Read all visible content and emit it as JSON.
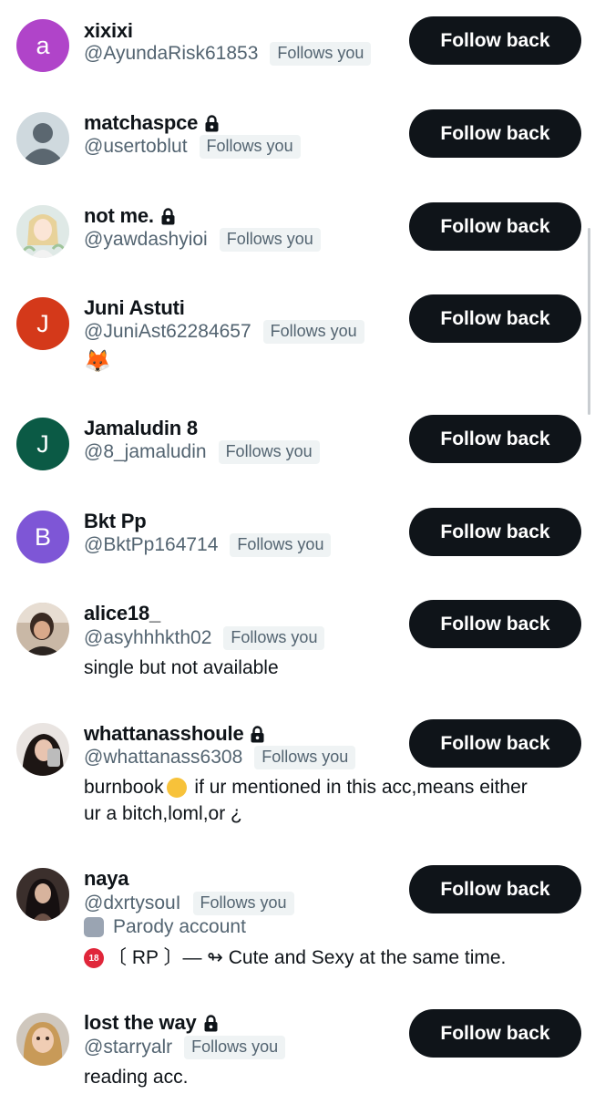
{
  "follows_badge": "Follows you",
  "button_label": "Follow back",
  "users": [
    {
      "name": "xixixi",
      "handle": "@AyundaRisk61853",
      "locked": false,
      "avatar_letter": "a",
      "avatar_color": "#b044c9"
    },
    {
      "name": "matchaspce",
      "handle": "@usertoblut",
      "locked": true,
      "avatar_type": "default"
    },
    {
      "name": "not me.",
      "handle": "@yawdashyioi",
      "locked": true,
      "avatar_type": "drawing"
    },
    {
      "name": "Juni Astuti",
      "handle": "@JuniAst62284657",
      "locked": false,
      "avatar_letter": "J",
      "avatar_color": "#d4391a",
      "bio": "🦊"
    },
    {
      "name": "Jamaludin 8",
      "handle": "@8_jamaludin",
      "locked": false,
      "avatar_letter": "J",
      "avatar_color": "#0b5a45"
    },
    {
      "name": "Bkt Pp",
      "handle": "@BktPp164714",
      "locked": false,
      "avatar_letter": "B",
      "avatar_color": "#7e56d6"
    },
    {
      "name": "alice18_",
      "handle": "@asyhhhkth02",
      "locked": false,
      "avatar_type": "photo",
      "bio": "single but not available"
    },
    {
      "name": "whattanasshoule",
      "handle": "@whattanass6308",
      "locked": true,
      "avatar_type": "photo",
      "bio_part1": "burnbook",
      "bio_part2": " if ur mentioned in this acc,means either",
      "bio_line2": "ur a bitch,loml,or ¿"
    },
    {
      "name": "naya",
      "handle": "@dxrtysouI",
      "locked": false,
      "avatar_type": "photo",
      "parody_label": "Parody account",
      "bio_badge": "18",
      "bio": "〔 RP 〕— ↬ Cute and Sexy at the same time."
    },
    {
      "name": "lost the way",
      "handle": "@starryalr",
      "locked": true,
      "avatar_type": "photo",
      "bio": "reading acc."
    }
  ]
}
